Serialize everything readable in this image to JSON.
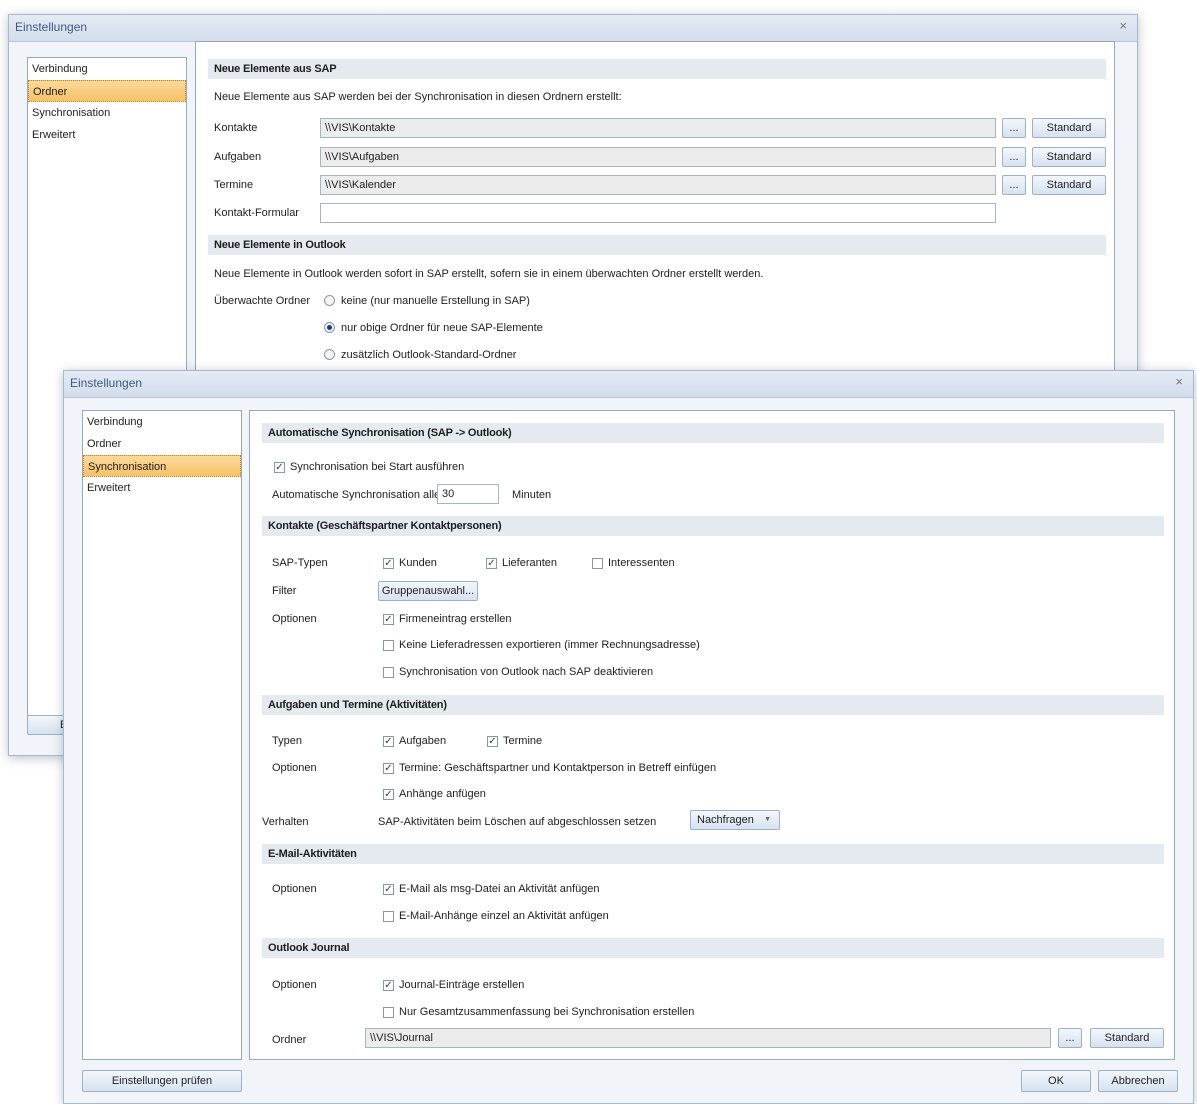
{
  "back_window": {
    "title": "Einstellungen",
    "close_glyph": "×",
    "nav": [
      {
        "label": "Verbindung",
        "selected": false
      },
      {
        "label": "Ordner",
        "selected": true
      },
      {
        "label": "Synchronisation",
        "selected": false
      },
      {
        "label": "Erweitert",
        "selected": false
      }
    ],
    "button_partial": "E",
    "section1": {
      "header": "Neue Elemente aus SAP",
      "intro": "Neue Elemente aus SAP werden bei der Synchronisation in diesen Ordnern erstellt:",
      "rows": [
        {
          "label": "Kontakte",
          "value": "\\\\VIS\\Kontakte",
          "browse": "...",
          "standard": "Standard"
        },
        {
          "label": "Aufgaben",
          "value": "\\\\VIS\\Aufgaben",
          "browse": "...",
          "standard": "Standard"
        },
        {
          "label": "Termine",
          "value": "\\\\VIS\\Kalender",
          "browse": "...",
          "standard": "Standard"
        }
      ],
      "form_label": "Kontakt-Formular",
      "form_value": ""
    },
    "section2": {
      "header": "Neue Elemente in Outlook",
      "intro": "Neue Elemente in Outlook werden sofort in SAP erstellt, sofern sie in einem überwachten Ordner erstellt werden.",
      "watched_label": "Überwachte Ordner",
      "options": [
        {
          "label": "keine (nur manuelle Erstellung in SAP)",
          "selected": false
        },
        {
          "label": "nur obige Ordner für neue SAP-Elemente",
          "selected": true
        },
        {
          "label": "zusätzlich Outlook-Standard-Ordner",
          "selected": false
        }
      ]
    }
  },
  "front_window": {
    "title": "Einstellungen",
    "close_glyph": "×",
    "nav": [
      {
        "label": "Verbindung",
        "selected": false
      },
      {
        "label": "Ordner",
        "selected": false
      },
      {
        "label": "Synchronisation",
        "selected": true
      },
      {
        "label": "Erweitert",
        "selected": false
      }
    ],
    "auto": {
      "header": "Automatische Synchronisation (SAP -> Outlook)",
      "start_label": "Synchronisation bei Start ausführen",
      "start_checked": true,
      "interval_label": "Automatische Synchronisation alle",
      "interval_value": "30",
      "interval_unit": "Minuten"
    },
    "contacts": {
      "header": "Kontakte (Geschäftspartner Kontaktpersonen)",
      "types_label": "SAP-Typen",
      "types": [
        {
          "label": "Kunden",
          "checked": true
        },
        {
          "label": "Lieferanten",
          "checked": true
        },
        {
          "label": "Interessenten",
          "checked": false
        }
      ],
      "filter_label": "Filter",
      "filter_button": "Gruppenauswahl...",
      "options_label": "Optionen",
      "options": [
        {
          "label": "Firmeneintrag erstellen",
          "checked": true
        },
        {
          "label": "Keine Lieferadressen exportieren (immer Rechnungsadresse)",
          "checked": false
        },
        {
          "label": "Synchronisation von Outlook nach SAP deaktivieren",
          "checked": false
        }
      ]
    },
    "tasks": {
      "header": "Aufgaben und Termine (Aktivitäten)",
      "types_label": "Typen",
      "types": [
        {
          "label": "Aufgaben",
          "checked": true
        },
        {
          "label": "Termine",
          "checked": true
        }
      ],
      "options_label": "Optionen",
      "options": [
        {
          "label": "Termine: Geschäftspartner und Kontaktperson in Betreff einfügen",
          "checked": true
        },
        {
          "label": "Anhänge anfügen",
          "checked": true
        }
      ],
      "behavior_label": "Verhalten",
      "behavior_text": "SAP-Aktivitäten beim Löschen auf abgeschlossen setzen",
      "behavior_value": "Nachfragen"
    },
    "email": {
      "header": "E-Mail-Aktivitäten",
      "options_label": "Optionen",
      "options": [
        {
          "label": "E-Mail als msg-Datei an Aktivität anfügen",
          "checked": true
        },
        {
          "label": "E-Mail-Anhänge einzel an Aktivität anfügen",
          "checked": false
        }
      ]
    },
    "journal": {
      "header": "Outlook Journal",
      "options_label": "Optionen",
      "options": [
        {
          "label": "Journal-Einträge erstellen",
          "checked": true
        },
        {
          "label": "Nur Gesamtzusammenfassung bei Synchronisation erstellen",
          "checked": false
        }
      ],
      "folder_label": "Ordner",
      "folder_value": "\\\\VIS\\Journal",
      "browse": "...",
      "standard": "Standard"
    },
    "footer": {
      "test_button": "Einstellungen prüfen",
      "ok_button": "OK",
      "cancel_button": "Abbrechen"
    },
    "check_glyph": "✓",
    "dropdown_glyph": "▼"
  }
}
